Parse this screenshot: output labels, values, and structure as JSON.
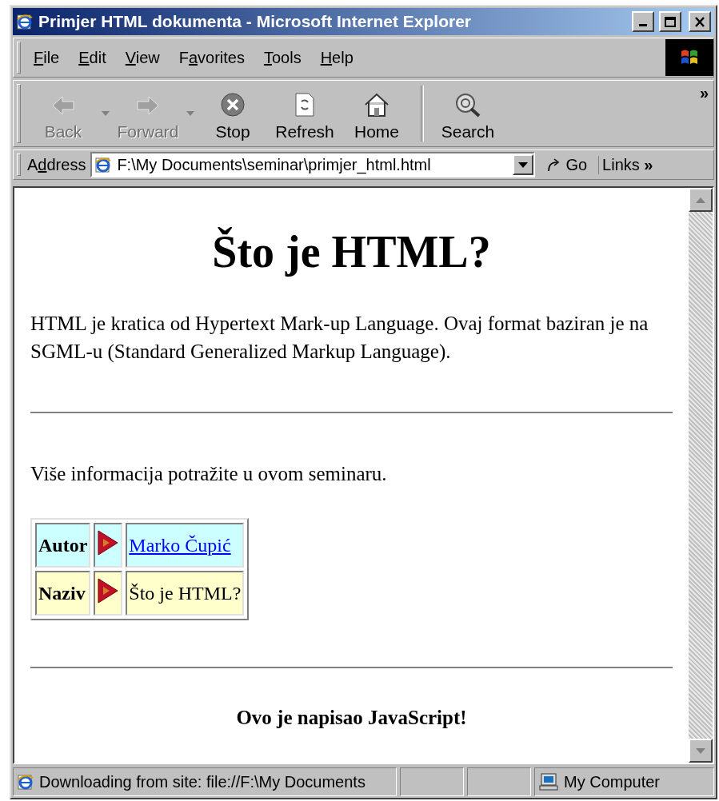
{
  "window": {
    "title": "Primjer HTML dokumenta - Microsoft Internet Explorer"
  },
  "menu": [
    {
      "accel": "F",
      "after": "ile"
    },
    {
      "accel": "E",
      "after": "dit"
    },
    {
      "accel": "V",
      "after": "iew"
    },
    {
      "before": "F",
      "accel": "a",
      "after": "vorites"
    },
    {
      "accel": "T",
      "after": "ools"
    },
    {
      "accel": "H",
      "after": "elp"
    }
  ],
  "toolbar": {
    "buttons": [
      {
        "label": "Back",
        "kind": "back",
        "disabled": true,
        "dropdown": true
      },
      {
        "label": "Forward",
        "kind": "forward",
        "disabled": true,
        "dropdown": true
      },
      {
        "label": "Stop",
        "kind": "stop",
        "disabled": false,
        "dropdown": false
      },
      {
        "label": "Refresh",
        "kind": "refresh",
        "disabled": false,
        "dropdown": false
      },
      {
        "label": "Home",
        "kind": "home",
        "disabled": false,
        "dropdown": false
      },
      {
        "label": "Search",
        "kind": "search",
        "disabled": false,
        "dropdown": false
      }
    ],
    "overflow": "»"
  },
  "address_bar": {
    "label": {
      "before": "A",
      "accel": "d",
      "after": "dress"
    },
    "value": "F:\\My Documents\\seminar\\primjer_html.html",
    "go": "Go",
    "links": "Links",
    "links_overflow": "»"
  },
  "page": {
    "heading": "Što je HTML?",
    "paragraph": "HTML je kratica od Hypertext Mark-up Language. Ovaj format baziran je na SGML-u (Standard Generalized Markup Language).",
    "note": "Više informacija potražite u ovom seminaru.",
    "table": [
      {
        "label": "Autor",
        "value": "Marko Čupić",
        "kind": "link",
        "color": "#ccffff"
      },
      {
        "label": "Naziv",
        "value": "Što je HTML?",
        "kind": "text",
        "color": "#ffffcc"
      }
    ],
    "footer": "Ovo je napisao JavaScript!"
  },
  "status_bar": {
    "text": "Downloading from site: file://F:\\My Documents",
    "zone": "My Computer"
  }
}
